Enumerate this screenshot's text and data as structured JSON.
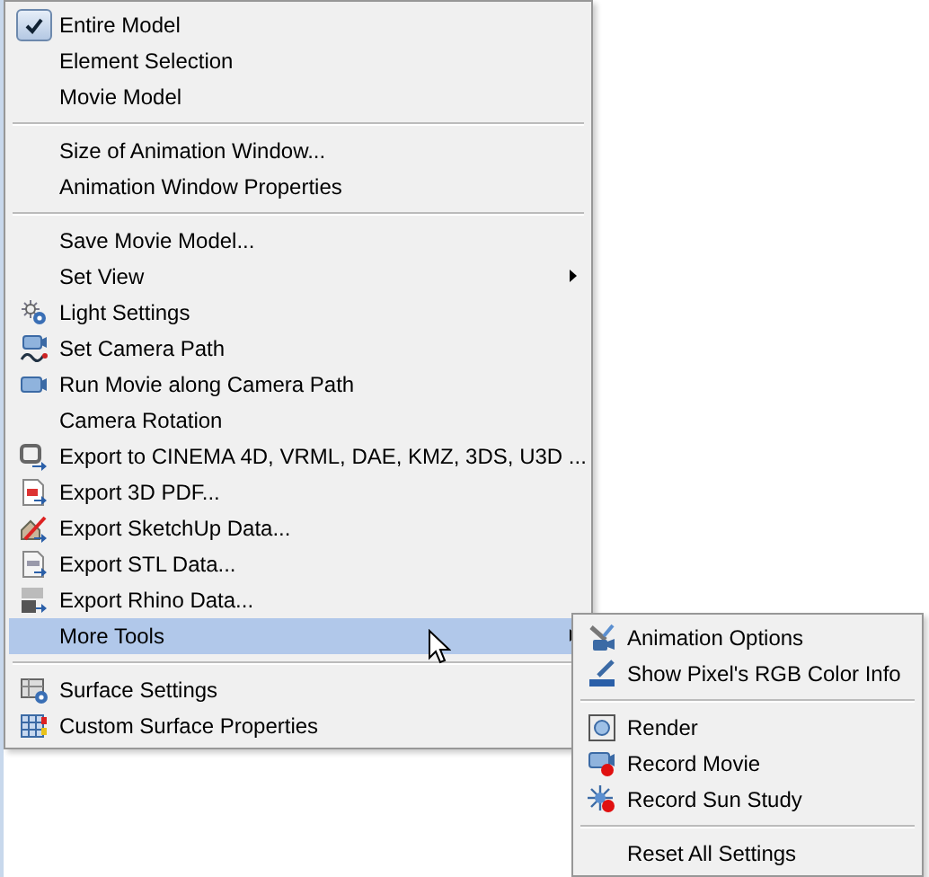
{
  "main_menu": {
    "groups": [
      {
        "items": [
          {
            "label": "Entire Model",
            "checked": true,
            "selected": false,
            "submenu": false
          },
          {
            "label": "Element Selection",
            "checked": false,
            "selected": false,
            "submenu": false
          },
          {
            "label": "Movie Model",
            "checked": false,
            "selected": false,
            "submenu": false
          }
        ]
      },
      {
        "items": [
          {
            "label": "Size of Animation Window...",
            "selected": false,
            "submenu": false
          },
          {
            "label": "Animation Window Properties",
            "selected": false,
            "submenu": false
          }
        ]
      },
      {
        "items": [
          {
            "label": "Save Movie Model...",
            "selected": false,
            "submenu": false
          },
          {
            "label": "Set View",
            "selected": false,
            "submenu": true
          },
          {
            "label": "Light Settings",
            "selected": false,
            "submenu": false
          },
          {
            "label": "Set Camera Path",
            "selected": false,
            "submenu": false
          },
          {
            "label": "Run Movie along Camera Path",
            "selected": false,
            "submenu": false
          },
          {
            "label": "Camera Rotation",
            "selected": false,
            "submenu": false
          },
          {
            "label": "Export to CINEMA 4D, VRML, DAE, KMZ, 3DS, U3D ...",
            "selected": false,
            "submenu": false
          },
          {
            "label": "Export 3D PDF...",
            "selected": false,
            "submenu": false
          },
          {
            "label": "Export SketchUp Data...",
            "selected": false,
            "submenu": false
          },
          {
            "label": "Export STL Data...",
            "selected": false,
            "submenu": false
          },
          {
            "label": "Export Rhino Data...",
            "selected": false,
            "submenu": false
          },
          {
            "label": "More Tools",
            "selected": true,
            "submenu": true
          }
        ]
      },
      {
        "items": [
          {
            "label": "Surface Settings",
            "selected": false,
            "submenu": false
          },
          {
            "label": "Custom Surface Properties",
            "selected": false,
            "submenu": false
          }
        ]
      }
    ]
  },
  "submenu": {
    "groups": [
      {
        "items": [
          {
            "label": "Animation Options",
            "selected": false
          },
          {
            "label": "Show Pixel's RGB Color Info",
            "selected": false
          }
        ]
      },
      {
        "items": [
          {
            "label": "Render",
            "selected": false
          },
          {
            "label": "Record Movie",
            "selected": false
          },
          {
            "label": "Record Sun Study",
            "selected": false
          }
        ]
      },
      {
        "items": [
          {
            "label": "Reset All Settings",
            "selected": false
          }
        ]
      }
    ]
  }
}
